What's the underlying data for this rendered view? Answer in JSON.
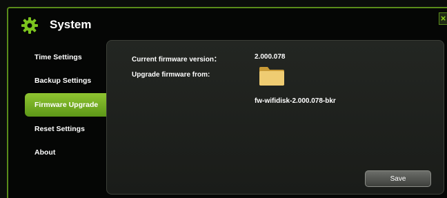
{
  "window": {
    "title": "System",
    "close_glyph": "×"
  },
  "sidebar": {
    "items": [
      {
        "label": "Time Settings",
        "active": false
      },
      {
        "label": "Backup Settings",
        "active": false
      },
      {
        "label": "Firmware Upgrade",
        "active": true
      },
      {
        "label": "Reset Settings",
        "active": false
      },
      {
        "label": "About",
        "active": false
      }
    ]
  },
  "firmware": {
    "current_label": "Current firmware version：",
    "current_value": "2.000.078",
    "upgrade_label": "Upgrade firmware from:",
    "file_name": "fw-wifidisk-2.000.078-bkr"
  },
  "actions": {
    "save_label": "Save"
  },
  "colors": {
    "accent": "#8fc431",
    "panel": "#232622",
    "folder": "#e8c46a"
  },
  "icons": {
    "title": "gear-icon",
    "file": "folder-icon",
    "close": "close-icon"
  }
}
